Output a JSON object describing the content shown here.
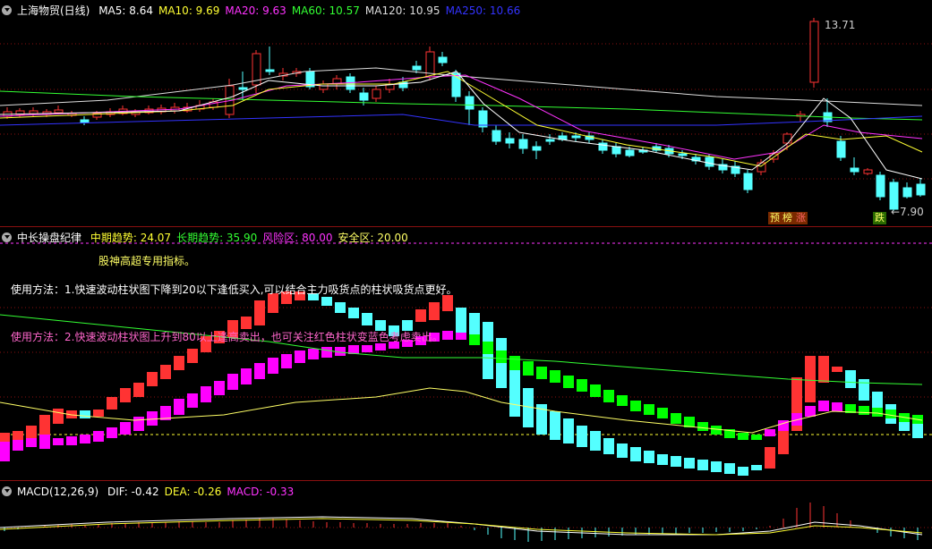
{
  "main_panel": {
    "title": "上海物贸(日线)",
    "ma": [
      {
        "label": "MA5: 8.64",
        "color": "#ffffff"
      },
      {
        "label": "MA10: 9.69",
        "color": "#ffff33"
      },
      {
        "label": "MA20: 9.63",
        "color": "#ff33ff"
      },
      {
        "label": "MA60: 10.57",
        "color": "#33ff33"
      },
      {
        "label": "MA120: 10.95",
        "color": "#dddddd"
      },
      {
        "label": "MA250: 10.66",
        "color": "#3333ff"
      }
    ],
    "high_label": "13.71",
    "low_label": "←7.90",
    "tags": {
      "tag1": "预",
      "tag2": "榜",
      "tag3": "涨",
      "tag4": "跌"
    }
  },
  "indicator_panel": {
    "title": "中长操盘纪律",
    "values": [
      {
        "label": "中期趋势: 24.07",
        "color": "#ffff33"
      },
      {
        "label": "长期趋势: 35.90",
        "color": "#33ff33"
      },
      {
        "label": "风险区: 80.00",
        "color": "#ff33ff"
      },
      {
        "label": "安全区: 20.00",
        "color": "#ffff66"
      }
    ],
    "note_title": "股神高超专用指标。",
    "usage1": "使用方法：1.快速波动柱状图下降到20以下逢低买入,可以结合主力吸货点的柱状吸货点更好。",
    "usage2": "使用方法：2.快速波动柱状图上升到80以上逢高卖出，也可关注红色柱状变蓝色考虑卖出。"
  },
  "macd_panel": {
    "title": "MACD(12,26,9)",
    "values": [
      {
        "label": "DIF: -0.42",
        "color": "#ffffff"
      },
      {
        "label": "DEA: -0.26",
        "color": "#ffff33"
      },
      {
        "label": "MACD: -0.33",
        "color": "#ff33ff"
      }
    ]
  },
  "colors": {
    "up": "#ff3333",
    "down": "#54ffff",
    "grid": "#8a1010"
  }
}
